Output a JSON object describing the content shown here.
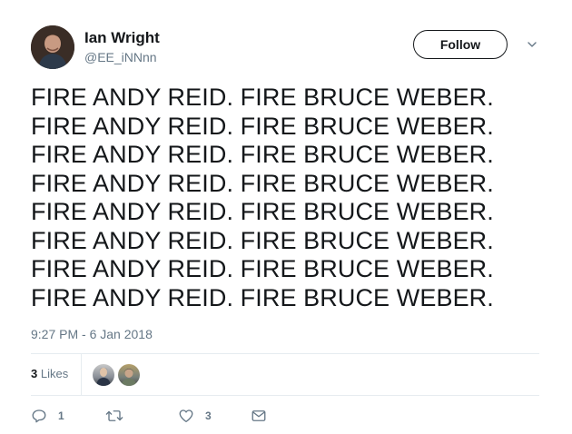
{
  "author": {
    "name": "Ian Wright",
    "handle": "@EE_iNNnn",
    "avatar_icon": "profile-photo"
  },
  "header": {
    "follow_label": "Follow",
    "menu_icon": "chevron-down-icon"
  },
  "tweet": {
    "lines": [
      "FIRE ANDY REID. FIRE BRUCE WEBER.",
      "FIRE ANDY REID. FIRE BRUCE WEBER.",
      "FIRE ANDY REID. FIRE BRUCE WEBER.",
      "FIRE ANDY REID. FIRE BRUCE WEBER.",
      "FIRE ANDY REID. FIRE BRUCE WEBER.",
      "FIRE ANDY REID. FIRE BRUCE WEBER.",
      "FIRE ANDY REID. FIRE BRUCE WEBER.",
      "FIRE ANDY REID. FIRE BRUCE WEBER."
    ],
    "timestamp": "9:27 PM - 6 Jan 2018"
  },
  "stats": {
    "likes_count": "3",
    "likes_label": "Likes"
  },
  "actions": {
    "reply_count": "1",
    "retweet_count": "",
    "like_count": "3"
  },
  "colors": {
    "text": "#14171a",
    "muted": "#657786",
    "border": "#e6ecf0"
  }
}
